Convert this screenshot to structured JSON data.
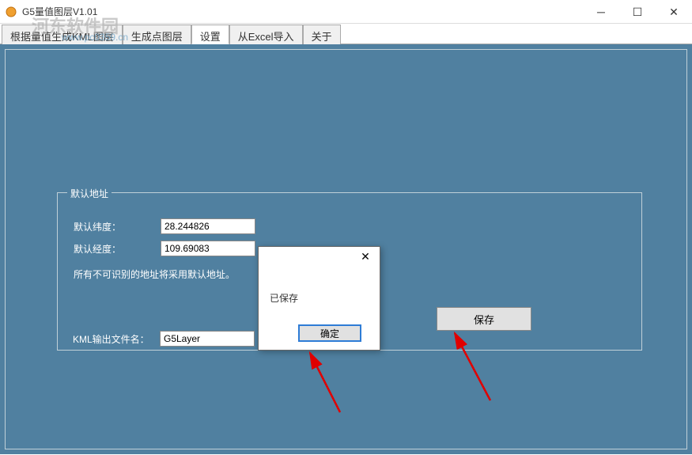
{
  "window": {
    "title": "G5量值图层V1.01"
  },
  "watermark": {
    "text": "河东软件园",
    "url": "www.pc0359.cn"
  },
  "tabs": [
    {
      "label": "根据量值生成KML图层"
    },
    {
      "label": "生成点图层"
    },
    {
      "label": "设置"
    },
    {
      "label": "从Excel导入"
    },
    {
      "label": "关于"
    }
  ],
  "groupbox": {
    "title": "默认地址",
    "lat_label": "默认纬度：",
    "lat_value": "28.244826",
    "lon_label": "默认经度：",
    "lon_value": "109.69083",
    "note": "所有不可识别的地址将采用默认地址。"
  },
  "output": {
    "label": "KML输出文件名：",
    "value": "G5Layer"
  },
  "buttons": {
    "save": "保存"
  },
  "dialog": {
    "message": "已保存",
    "ok": "确定"
  }
}
